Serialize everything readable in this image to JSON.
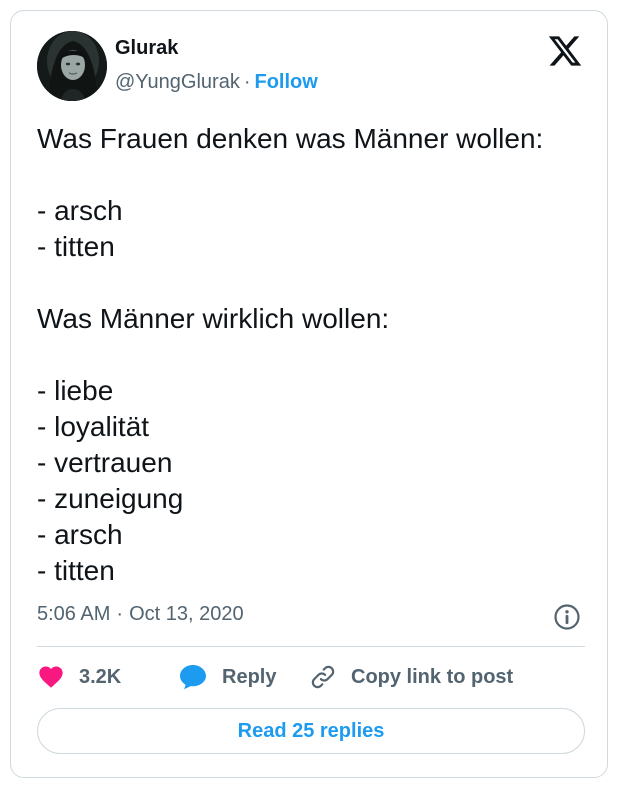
{
  "author": {
    "name": "Glurak",
    "handle": "@YungGlurak",
    "separator": "·",
    "follow_label": "Follow",
    "avatar_icon": "profile-photo"
  },
  "platform_icon": "x-logo-icon",
  "tweet": {
    "text": "Was Frauen denken was Männer wollen:\n\n- arsch\n- titten\n\nWas Männer wirklich wollen:\n\n- liebe\n- loyalität\n- vertrauen\n- zuneigung\n- arsch\n- titten"
  },
  "meta": {
    "time": "5:06 AM",
    "separator": "·",
    "date": "Oct 13, 2020",
    "info_icon": "info-icon"
  },
  "actions": {
    "like_count": "3.2K",
    "reply_label": "Reply",
    "copy_link_label": "Copy link to post"
  },
  "read_replies_label": "Read 25 replies",
  "colors": {
    "accent": "#1d9bf0",
    "like": "#f91880",
    "text": "#0f1419",
    "muted": "#536471",
    "border": "#cfd9de"
  }
}
